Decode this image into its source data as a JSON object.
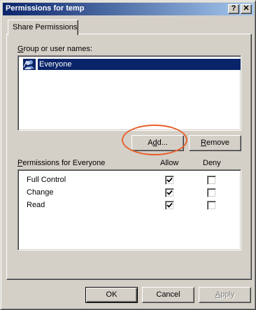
{
  "window": {
    "title": "Permissions for temp",
    "help_button": "?",
    "close_button": "✕"
  },
  "tabs": [
    {
      "label": "Share Permissions",
      "selected": true
    }
  ],
  "users": {
    "label_accel": "G",
    "label_rest": "roup or user names:",
    "items": [
      {
        "name": "Everyone",
        "icon": "group-users-icon",
        "selected": true
      }
    ]
  },
  "actions": {
    "add_accel": "d",
    "add_pre": "A",
    "add_post": "d...",
    "remove_accel": "R",
    "remove_rest": "emove",
    "add_highlight_color": "#e8602c"
  },
  "permissions": {
    "label_accel": "P",
    "label_rest": "ermissions for Everyone",
    "col_allow": "Allow",
    "col_deny": "Deny",
    "rows": [
      {
        "name": "Full Control",
        "allow": true,
        "deny": false
      },
      {
        "name": "Change",
        "allow": true,
        "deny": false
      },
      {
        "name": "Read",
        "allow": true,
        "deny": false
      }
    ]
  },
  "footer": {
    "ok": "OK",
    "cancel": "Cancel",
    "apply_accel": "A",
    "apply_rest": "pply"
  },
  "colors": {
    "face": "#d4d0c8",
    "selection": "#0a246a",
    "title_gradient_start": "#0a246a",
    "title_gradient_end": "#a6caf0"
  }
}
